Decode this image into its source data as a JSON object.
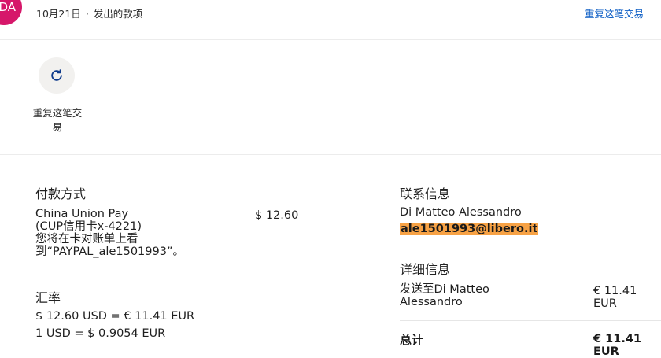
{
  "header": {
    "avatar_initials": "DA",
    "date": "10月21日",
    "separator": "·",
    "status": "发出的款项",
    "repeat_link": "重复这笔交易"
  },
  "actions": {
    "repeat_label": "重复这笔交易",
    "repeat_icon": "refresh-icon"
  },
  "payment": {
    "heading": "付款方式",
    "method_line1": "China Union Pay",
    "method_line2": "(CUP信用卡x-4221)",
    "statement_note": "您将在卡对账单上看到“PAYPAL_ale1501993”。",
    "amount": "$ 12.60"
  },
  "exchange": {
    "heading": "汇率",
    "line1": "$ 12.60 USD = € 11.41 EUR",
    "line2": "1 USD = $ 0.9054 EUR"
  },
  "contact": {
    "heading": "联系信息",
    "name": "Di Matteo Alessandro",
    "email": "ale1501993@libero.it"
  },
  "details": {
    "heading": "详细信息",
    "sent_to": "发送至Di Matteo Alessandro",
    "sent_amount": "€ 11.41 EUR",
    "total_label": "总计",
    "total_amount": "€ 11.41 EUR"
  },
  "colors": {
    "avatar_bg": "#d6176a",
    "link": "#0d5ec5",
    "email_highlight": "#f7a245"
  }
}
